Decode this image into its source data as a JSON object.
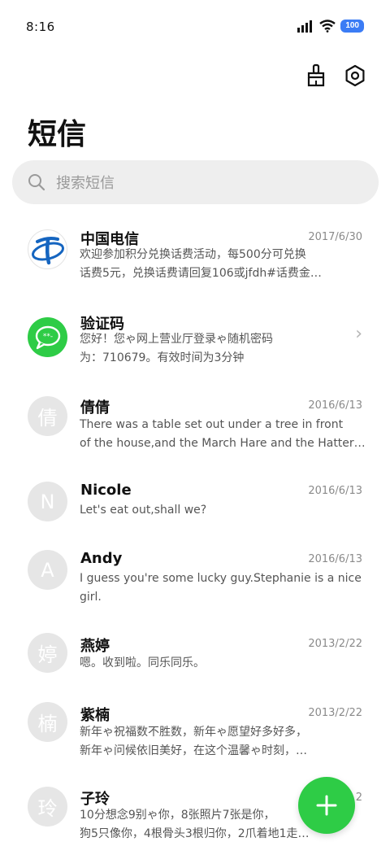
{
  "status": {
    "time": "8:16",
    "battery": "100"
  },
  "header": {
    "title": "短信",
    "clean_icon": "broom-icon",
    "settings_icon": "settings-icon"
  },
  "search": {
    "placeholder": "搜索短信"
  },
  "conversations": [
    {
      "name": "中国电信",
      "date": "2017/6/30",
      "avatar_type": "telecom-logo",
      "preview": [
        "欢迎参加积分兑换话费活动，每500分可兑换",
        "话费5元，兑换话费请回复106或jfdh#话费金…"
      ]
    },
    {
      "name": "验证码",
      "date": "",
      "avatar_type": "message-bubble",
      "preview": [
        "您好！您ゃ网上营业厅登录ゃ随机密码",
        "为：710679。有效时间为3分钟"
      ]
    },
    {
      "name": "倩倩",
      "date": "2016/6/13",
      "avatar": "倩",
      "preview": [
        "There was a table set out under a tree in front",
        "of the house,and the March Hare and the Hatter…"
      ]
    },
    {
      "name": "Nicole",
      "date": "2016/6/13",
      "avatar": "N",
      "preview": [
        "Let's eat out,shall we?"
      ]
    },
    {
      "name": "Andy",
      "date": "2016/6/13",
      "avatar": "A",
      "preview": [
        "I guess you're some lucky guy.Stephanie is a nice",
        "girl."
      ]
    },
    {
      "name": "燕婷",
      "date": "2013/2/22",
      "avatar": "婷",
      "preview": [
        "嗯。收到啦。同乐同乐。"
      ]
    },
    {
      "name": "紫楠",
      "date": "2013/2/22",
      "avatar": "楠",
      "preview": [
        "新年ゃ祝福数不胜数，新年ゃ愿望好多好多，",
        "新年ゃ问候依旧美好，在这个温馨ゃ时刻，…"
      ]
    },
    {
      "name": "子玲",
      "date": "2",
      "avatar": "玲",
      "preview": [
        "10分想念9别ゃ你，8张照片7张是你，",
        "狗5只像你，4根骨头3根归你，2爪着地1走…"
      ]
    }
  ],
  "fab": {
    "icon": "plus-icon"
  },
  "colors": {
    "accent_green": "#2ecc46",
    "telecom_blue": "#1565c0",
    "battery_blue": "#3b7cf5"
  }
}
